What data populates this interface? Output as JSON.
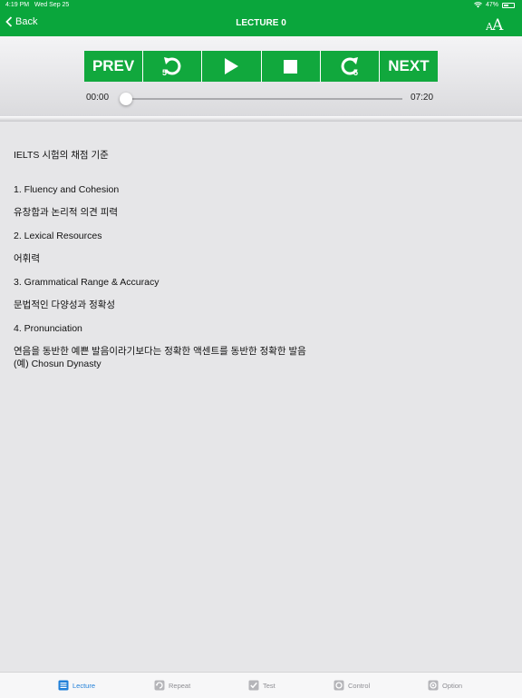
{
  "status_bar": {
    "time": "4:19 PM",
    "date": "Wed Sep 25",
    "battery": "47%",
    "battery_level": 0.47
  },
  "nav": {
    "back_label": "Back",
    "title": "LECTURE 0",
    "font_size_icon": "font-size-icon"
  },
  "controls": {
    "prev_label": "PREV",
    "rewind_seconds": "5",
    "forward_seconds": "5",
    "next_label": "NEXT"
  },
  "progress": {
    "current": "00:00",
    "total": "07:20",
    "fraction": 0.0
  },
  "content": {
    "lines": [
      "IELTS 시험의 채점 기준",
      "1. Fluency and Cohesion",
      "유창함과 논리적 의견 피력",
      "2. Lexical Resources",
      "어휘력",
      "3. Grammatical Range & Accuracy",
      "문법적인 다양성과 정확성",
      "4. Pronunciation",
      "연음을 동반한 예쁜 발음이라기보다는 정확한 액센트를 동반한 정확한 발음",
      "(예) Chosun Dynasty"
    ]
  },
  "tabs": [
    {
      "label": "Lecture",
      "icon": "list-icon"
    },
    {
      "label": "Repeat",
      "icon": "repeat-icon"
    },
    {
      "label": "Test",
      "icon": "checkbox-icon"
    },
    {
      "label": "Control",
      "icon": "control-icon"
    },
    {
      "label": "Option",
      "icon": "option-icon"
    }
  ],
  "colors": {
    "brand_green": "#0aa63c",
    "tab_active": "#1f7fd8",
    "tab_inactive": "#8e8e93"
  }
}
